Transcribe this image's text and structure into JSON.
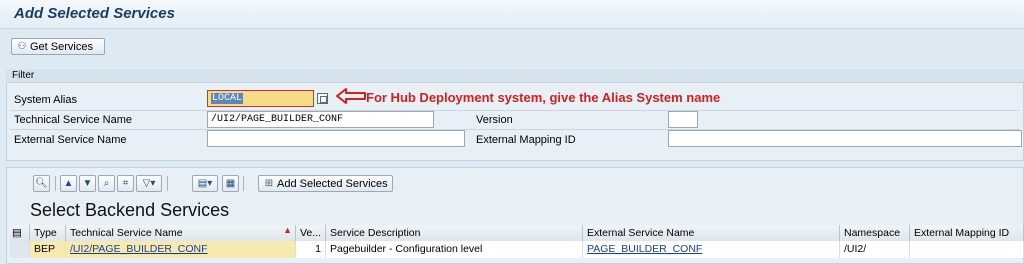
{
  "page": {
    "title": "Add Selected Services"
  },
  "toolbar": {
    "get_services": "Get Services"
  },
  "filter": {
    "header": "Filter",
    "system_alias_label": "System Alias",
    "system_alias_value": "LOCAL",
    "technical_service_name_label": "Technical Service Name",
    "technical_service_name_value": "/UI2/PAGE_BUILDER_CONF",
    "external_service_name_label": "External Service Name",
    "external_service_name_value": "",
    "version_label": "Version",
    "version_value": "",
    "external_mapping_id_label": "External Mapping ID",
    "external_mapping_id_value": ""
  },
  "annotation": {
    "text": "For Hub Deployment system, give the Alias System name",
    "color": "#d21f1f"
  },
  "alv": {
    "add_selected_services": "Add Selected Services",
    "title": "Select Backend Services",
    "columns": [
      "Type",
      "Technical Service Name",
      "Ve...",
      "Service Description",
      "External Service Name",
      "Namespace",
      "External Mapping ID"
    ],
    "rows": [
      {
        "type": "BEP",
        "technical_service_name": "/UI2/PAGE_BUILDER_CONF",
        "version": "1",
        "service_description": "Pagebuilder - Configuration level",
        "external_service_name": "PAGE_BUILDER_CONF",
        "namespace": "/UI2/",
        "external_mapping_id": ""
      }
    ]
  },
  "colors": {
    "title": "#1a3f63",
    "background": "#dfe9f1",
    "highlight": "#f7dc86",
    "selection": "#5b87bd"
  }
}
